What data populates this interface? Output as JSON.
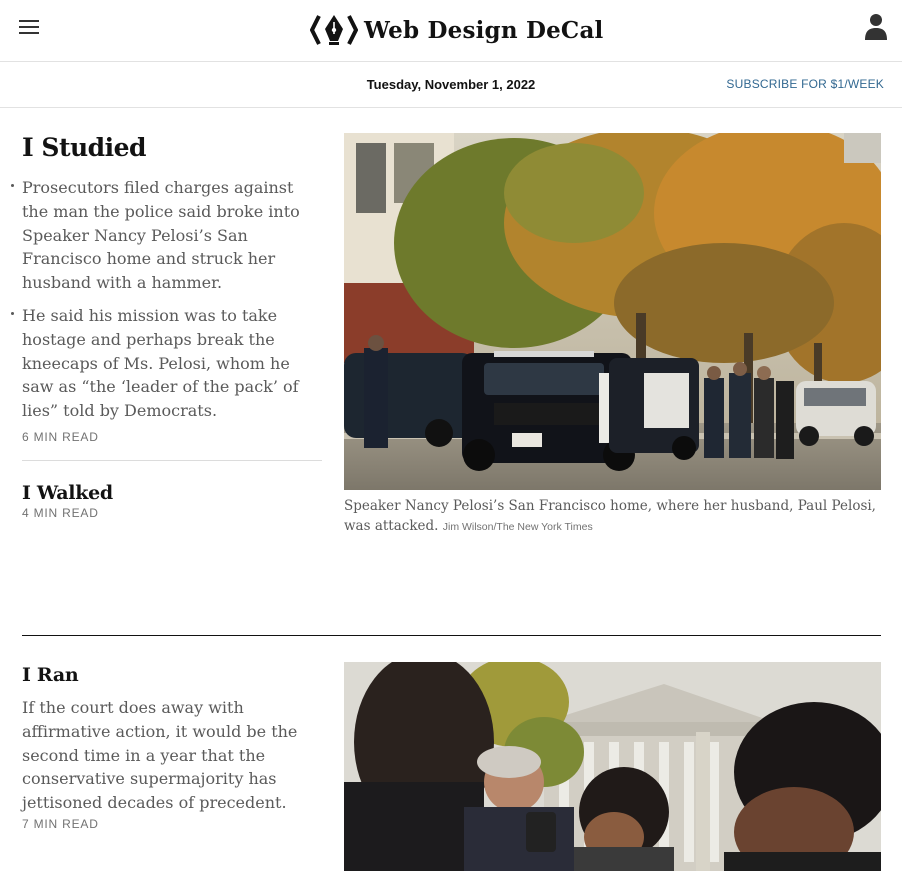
{
  "header": {
    "title": "Web Design DeCal",
    "date": "Tuesday, November 1, 2022",
    "subscribe_label": "SUBSCRIBE FOR $1/WEEK"
  },
  "story1": {
    "headline": "I Studied",
    "bullets": [
      "Prosecutors filed charges against the man the police said broke into Speaker Nancy Pelosi’s San Francisco home and struck her husband with a hammer.",
      "He said his mission was to take hostage and perhaps break the kneecaps of Ms. Pelosi, whom he saw as “the ‘leader of the pack’ of lies” told by Democrats."
    ],
    "read_time": "6 MIN READ",
    "caption": "Speaker Nancy Pelosi’s San Francisco home, where her husband, Paul Pelosi, was attacked.",
    "credit": "Jim Wilson/The New York Times"
  },
  "story2": {
    "headline": "I Walked",
    "read_time": "4 MIN READ"
  },
  "story3": {
    "headline": "I Ran",
    "summary": "If the court does away with affirmative action, it would be the second time in a year that the conservative supermajority has jettisoned decades of precedent.",
    "read_time": "7 MIN READ"
  },
  "icons": {
    "menu": "hamburger-menu-icon",
    "logo": "fountain-pen-code-icon",
    "account": "user-account-icon"
  },
  "colors": {
    "link": "#326891",
    "text": "#121212",
    "summary": "#5a5a5a"
  }
}
